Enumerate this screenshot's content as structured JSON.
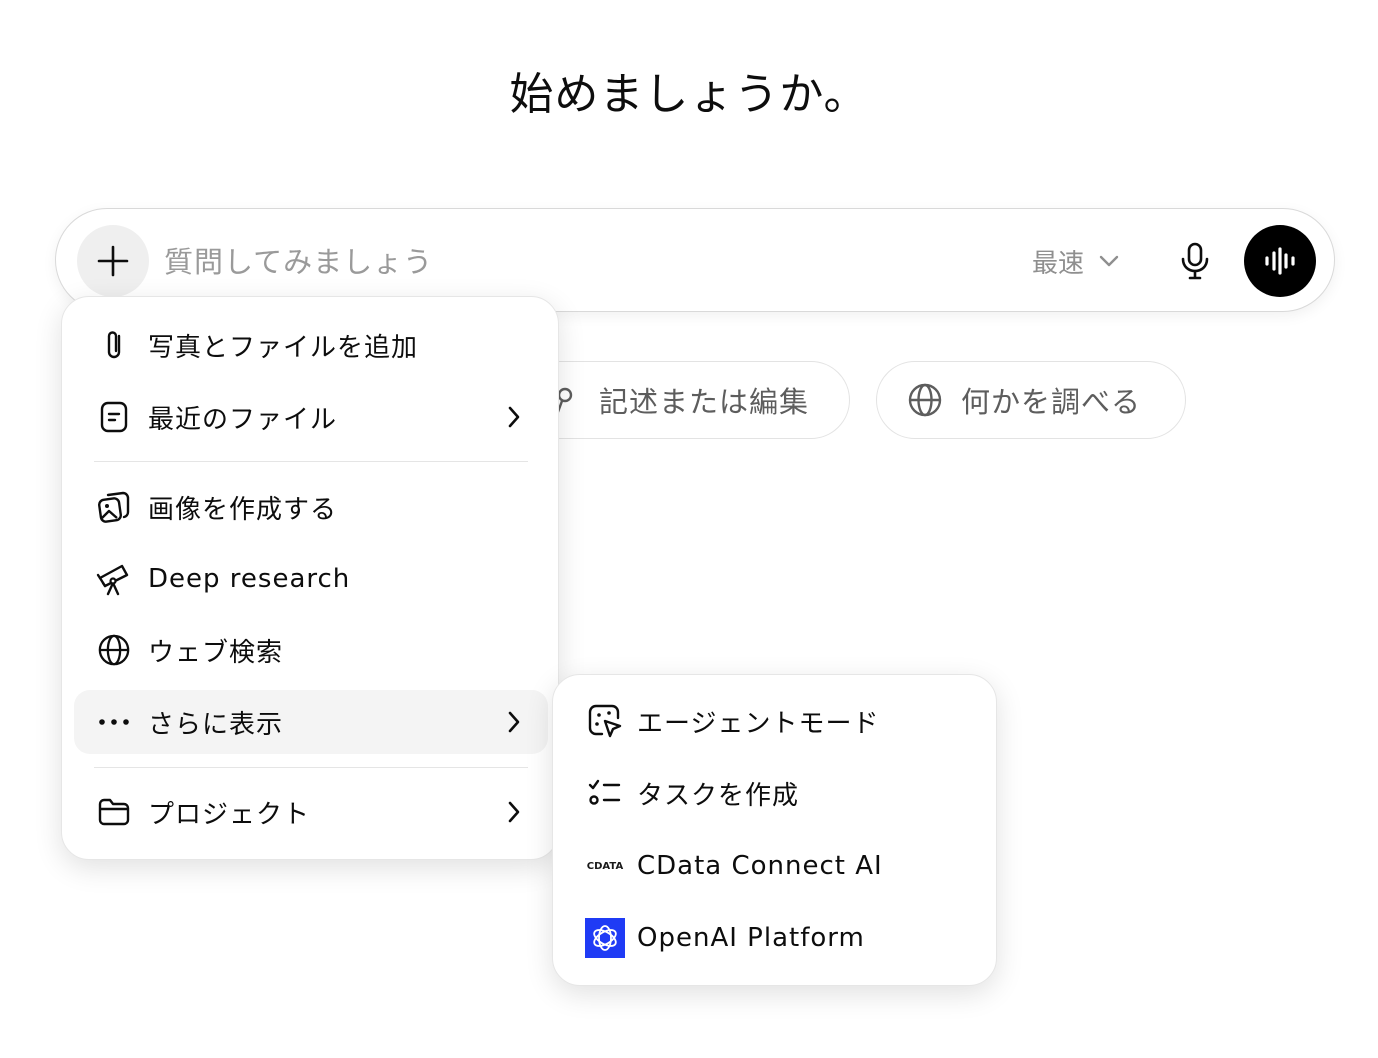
{
  "heading": "始めましょうか。",
  "composer": {
    "placeholder": "質問してみましょう",
    "model_label": "最速"
  },
  "suggestions": [
    {
      "label": "記述または編集",
      "icon": "pen-icon"
    },
    {
      "label": "何かを調べる",
      "icon": "globe-icon"
    }
  ],
  "menu": {
    "items": [
      {
        "label": "写真とファイルを追加",
        "icon": "paperclip-icon",
        "has_submenu": false
      },
      {
        "label": "最近のファイル",
        "icon": "file-icon",
        "has_submenu": true
      },
      {
        "label": "画像を作成する",
        "icon": "image-icon",
        "has_submenu": false
      },
      {
        "label": "Deep research",
        "icon": "telescope-icon",
        "has_submenu": false
      },
      {
        "label": "ウェブ検索",
        "icon": "globe-icon",
        "has_submenu": false
      },
      {
        "label": "さらに表示",
        "icon": "more-icon",
        "has_submenu": true
      },
      {
        "label": "プロジェクト",
        "icon": "folder-icon",
        "has_submenu": true
      }
    ]
  },
  "submenu": {
    "items": [
      {
        "label": "エージェントモード",
        "icon": "agent-icon"
      },
      {
        "label": "タスクを作成",
        "icon": "task-list-icon"
      },
      {
        "label": "CData Connect AI",
        "icon": "cdata-logo",
        "logo_text": "CDATA"
      },
      {
        "label": "OpenAI Platform",
        "icon": "openai-logo"
      }
    ]
  },
  "colors": {
    "voice_button": "#000000",
    "openai_logo_bg": "#1f3bf5",
    "placeholder": "#9a9a9a",
    "active_item_bg": "#f4f4f4"
  }
}
